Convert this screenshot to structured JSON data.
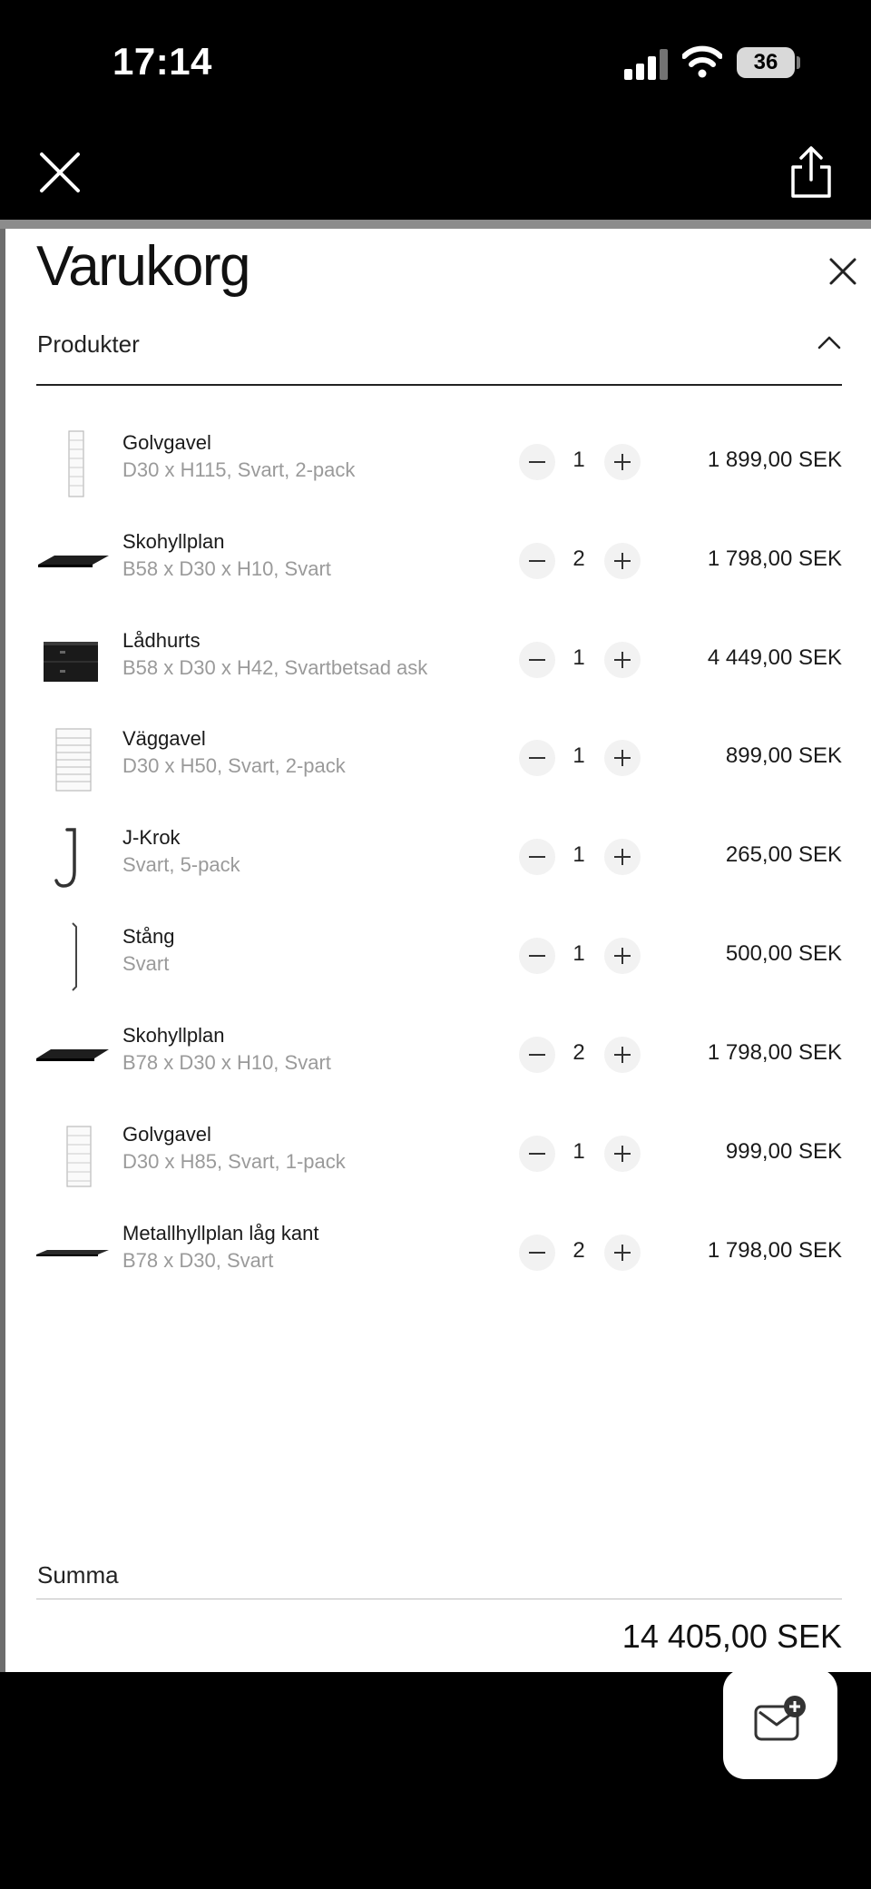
{
  "status_bar": {
    "time": "17:14",
    "battery": "36"
  },
  "top_bar": {
    "close_icon": "close-icon",
    "share_icon": "share-icon"
  },
  "cart": {
    "title": "Varukorg",
    "section_label": "Produkter",
    "items": [
      {
        "name": "Golvgavel",
        "desc": "D30 x H115, Svart, 2-pack",
        "qty": "1",
        "price": "1 899,00 SEK",
        "thumb": "ladder-tall"
      },
      {
        "name": "Skohyllplan",
        "desc": "B58 x D30 x H10, Svart",
        "qty": "2",
        "price": "1 798,00 SEK",
        "thumb": "shelf"
      },
      {
        "name": "Lådhurts",
        "desc": "B58 x D30 x H42, Svartbetsad ask",
        "qty": "1",
        "price": "4 449,00 SEK",
        "thumb": "drawer"
      },
      {
        "name": "Väggavel",
        "desc": "D30 x H50, Svart, 2-pack",
        "qty": "1",
        "price": "899,00 SEK",
        "thumb": "ladder-wide"
      },
      {
        "name": "J-Krok",
        "desc": "Svart, 5-pack",
        "qty": "1",
        "price": "265,00 SEK",
        "thumb": "hook"
      },
      {
        "name": "Stång",
        "desc": "Svart",
        "qty": "1",
        "price": "500,00 SEK",
        "thumb": "rod"
      },
      {
        "name": "Skohyllplan",
        "desc": "B78 x D30 x H10, Svart",
        "qty": "2",
        "price": "1 798,00 SEK",
        "thumb": "shelf"
      },
      {
        "name": "Golvgavel",
        "desc": "D30 x H85, Svart, 1-pack",
        "qty": "1",
        "price": "999,00 SEK",
        "thumb": "ladder-tall"
      },
      {
        "name": "Metallhyllplan låg kant",
        "desc": "B78 x D30, Svart",
        "qty": "2",
        "price": "1 798,00 SEK",
        "thumb": "flat-shelf"
      }
    ],
    "sum_label": "Summa",
    "total": "14 405,00 SEK"
  },
  "chat_button_icon": "chat-add-icon"
}
